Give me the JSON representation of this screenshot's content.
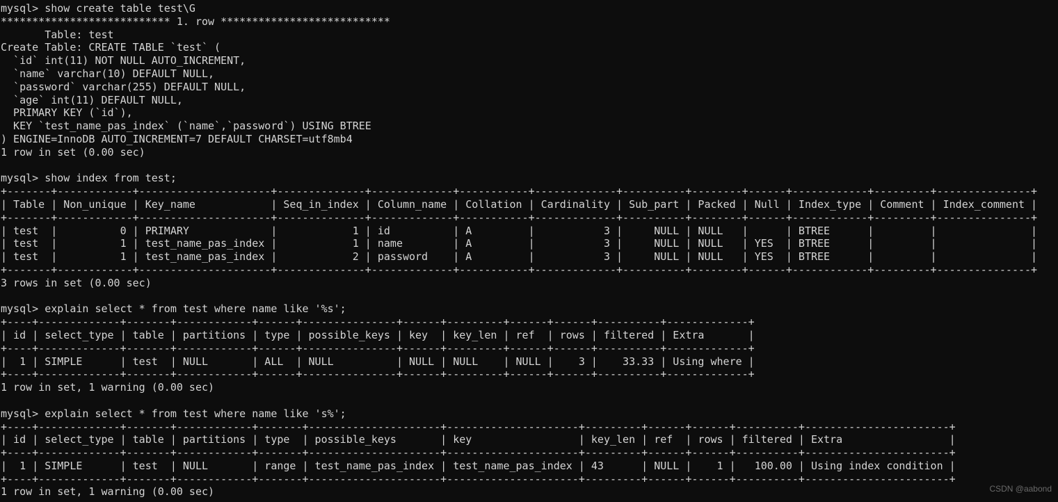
{
  "terminal": {
    "background_color": "#0d0d0d",
    "text_color": "#d4d4d4",
    "prompt": "mysql>",
    "lines": [
      "mysql> show create table test\\G",
      "*************************** 1. row ***************************",
      "       Table: test",
      "Create Table: CREATE TABLE `test` (",
      "  `id` int(11) NOT NULL AUTO_INCREMENT,",
      "  `name` varchar(10) DEFAULT NULL,",
      "  `password` varchar(255) DEFAULT NULL,",
      "  `age` int(11) DEFAULT NULL,",
      "  PRIMARY KEY (`id`),",
      "  KEY `test_name_pas_index` (`name`,`password`) USING BTREE",
      ") ENGINE=InnoDB AUTO_INCREMENT=7 DEFAULT CHARSET=utf8mb4",
      "1 row in set (0.00 sec)",
      "",
      "mysql> show index from test;",
      "+-------+------------+---------------------+--------------+-------------+-----------+-------------+----------+--------+------+------------+---------+---------------+",
      "| Table | Non_unique | Key_name            | Seq_in_index | Column_name | Collation | Cardinality | Sub_part | Packed | Null | Index_type | Comment | Index_comment |",
      "+-------+------------+---------------------+--------------+-------------+-----------+-------------+----------+--------+------+------------+---------+---------------+",
      "| test  |          0 | PRIMARY             |            1 | id          | A         |           3 |     NULL | NULL   |      | BTREE      |         |               |",
      "| test  |          1 | test_name_pas_index |            1 | name        | A         |           3 |     NULL | NULL   | YES  | BTREE      |         |               |",
      "| test  |          1 | test_name_pas_index |            2 | password    | A         |           3 |     NULL | NULL   | YES  | BTREE      |         |               |",
      "+-------+------------+---------------------+--------------+-------------+-----------+-------------+----------+--------+------+------------+---------+---------------+",
      "3 rows in set (0.00 sec)",
      "",
      "mysql> explain select * from test where name like '%s';",
      "+----+-------------+-------+------------+------+---------------+------+---------+------+------+----------+-------------+",
      "| id | select_type | table | partitions | type | possible_keys | key  | key_len | ref  | rows | filtered | Extra       |",
      "+----+-------------+-------+------------+------+---------------+------+---------+------+------+----------+-------------+",
      "|  1 | SIMPLE      | test  | NULL       | ALL  | NULL          | NULL | NULL    | NULL |    3 |    33.33 | Using where |",
      "+----+-------------+-------+------------+------+---------------+------+---------+------+------+----------+-------------+",
      "1 row in set, 1 warning (0.00 sec)",
      "",
      "mysql> explain select * from test where name like 's%';",
      "+----+-------------+-------+------------+-------+---------------------+---------------------+---------+------+------+----------+-----------------------+",
      "| id | select_type | table | partitions | type  | possible_keys       | key                 | key_len | ref  | rows | filtered | Extra                 |",
      "+----+-------------+-------+------------+-------+---------------------+---------------------+---------+------+------+----------+-----------------------+",
      "|  1 | SIMPLE      | test  | NULL       | range | test_name_pas_index | test_name_pas_index | 43      | NULL |    1 |   100.00 | Using index condition |",
      "+----+-------------+-------+------------+-------+---------------------+---------------------+---------+------+------+----------+-----------------------+",
      "1 row in set, 1 warning (0.00 sec)"
    ],
    "commands": [
      "show create table test\\G",
      "show index from test;",
      "explain select * from test where name like '%s';",
      "explain select * from test where name like 's%';"
    ],
    "create_table": {
      "row_header": "*************************** 1. row ***************************",
      "table_label": "Table:",
      "table_name": "test",
      "create_table_label": "Create Table:",
      "statement": "CREATE TABLE `test` (",
      "columns": [
        "`id` int(11) NOT NULL AUTO_INCREMENT,",
        "`name` varchar(10) DEFAULT NULL,",
        "`password` varchar(255) DEFAULT NULL,",
        "`age` int(11) DEFAULT NULL,",
        "PRIMARY KEY (`id`),",
        "KEY `test_name_pas_index` (`name`,`password`) USING BTREE"
      ],
      "options": ") ENGINE=InnoDB AUTO_INCREMENT=7 DEFAULT CHARSET=utf8mb4",
      "result_status": "1 row in set (0.00 sec)"
    },
    "index_table": {
      "headers": [
        "Table",
        "Non_unique",
        "Key_name",
        "Seq_in_index",
        "Column_name",
        "Collation",
        "Cardinality",
        "Sub_part",
        "Packed",
        "Null",
        "Index_type",
        "Comment",
        "Index_comment"
      ],
      "rows": [
        [
          "test",
          "0",
          "PRIMARY",
          "1",
          "id",
          "A",
          "3",
          "NULL",
          "NULL",
          "",
          "BTREE",
          "",
          ""
        ],
        [
          "test",
          "1",
          "test_name_pas_index",
          "1",
          "name",
          "A",
          "3",
          "NULL",
          "NULL",
          "YES",
          "BTREE",
          "",
          ""
        ],
        [
          "test",
          "1",
          "test_name_pas_index",
          "2",
          "password",
          "A",
          "3",
          "NULL",
          "NULL",
          "YES",
          "BTREE",
          "",
          ""
        ]
      ],
      "result_status": "3 rows in set (0.00 sec)"
    },
    "explain_table_1": {
      "headers": [
        "id",
        "select_type",
        "table",
        "partitions",
        "type",
        "possible_keys",
        "key",
        "key_len",
        "ref",
        "rows",
        "filtered",
        "Extra"
      ],
      "rows": [
        [
          "1",
          "SIMPLE",
          "test",
          "NULL",
          "ALL",
          "NULL",
          "NULL",
          "NULL",
          "NULL",
          "3",
          "33.33",
          "Using where"
        ]
      ],
      "result_status": "1 row in set, 1 warning (0.00 sec)"
    },
    "explain_table_2": {
      "headers": [
        "id",
        "select_type",
        "table",
        "partitions",
        "type",
        "possible_keys",
        "key",
        "key_len",
        "ref",
        "rows",
        "filtered",
        "Extra"
      ],
      "rows": [
        [
          "1",
          "SIMPLE",
          "test",
          "NULL",
          "range",
          "test_name_pas_index",
          "test_name_pas_index",
          "43",
          "NULL",
          "1",
          "100.00",
          "Using index condition"
        ]
      ],
      "result_status": "1 row in set, 1 warning (0.00 sec)"
    }
  },
  "watermark": {
    "text": "CSDN @aabond"
  }
}
